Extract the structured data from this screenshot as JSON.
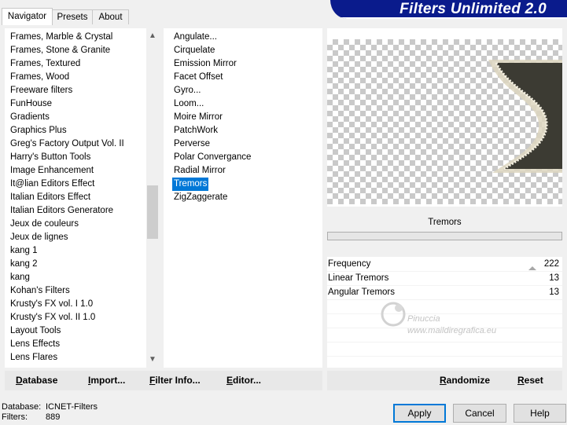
{
  "tabs": [
    {
      "label": "Navigator",
      "active": true
    },
    {
      "label": "Presets",
      "active": false
    },
    {
      "label": "About",
      "active": false
    }
  ],
  "banner": {
    "title": "Filters Unlimited 2.0"
  },
  "categories": [
    "Frames, Marble & Crystal",
    "Frames, Stone & Granite",
    "Frames, Textured",
    "Frames, Wood",
    "Freeware filters",
    "FunHouse",
    "Gradients",
    "Graphics Plus",
    "Greg's Factory Output Vol. II",
    "Harry's Button Tools",
    "Image Enhancement",
    "It@lian Editors Effect",
    "Italian Editors Effect",
    "Italian Editors Generatore",
    "Jeux de couleurs",
    "Jeux de lignes",
    "kang 1",
    "kang 2",
    "kang",
    "Kohan's Filters",
    "Krusty's FX vol. I 1.0",
    "Krusty's FX vol. II 1.0",
    "Layout Tools",
    "Lens Effects",
    "Lens Flares"
  ],
  "filters": [
    "Angulate...",
    "Cirquelate",
    "Emission Mirror",
    "Facet Offset",
    "Gyro...",
    "Loom...",
    "Moire Mirror",
    "PatchWork",
    "Perverse",
    "Polar Convergance",
    "Radial Mirror",
    "Tremors",
    "ZigZaggerate"
  ],
  "selected_filter": "Tremors",
  "preview": {
    "filter_name": "Tremors"
  },
  "params": [
    {
      "label": "Frequency",
      "value": "222",
      "slider": true
    },
    {
      "label": "Linear Tremors",
      "value": "13",
      "slider": false
    },
    {
      "label": "Angular Tremors",
      "value": "13",
      "slider": false
    }
  ],
  "watermark": {
    "name": "Pinuccia",
    "url": "www.maildiregrafica.eu"
  },
  "left_buttons": [
    {
      "ul": "D",
      "rest": "atabase"
    },
    {
      "ul": "I",
      "rest": "mport..."
    },
    {
      "ul": "F",
      "rest": "ilter Info..."
    },
    {
      "ul": "E",
      "rest": "ditor..."
    }
  ],
  "right_buttons": [
    {
      "ul": "R",
      "rest": "andomize"
    },
    {
      "ul": "R",
      "rest": "eset"
    }
  ],
  "status": {
    "database_label": "Database:",
    "database_value": "ICNET-Filters",
    "filters_label": "Filters:",
    "filters_value": "889"
  },
  "dialog": {
    "apply": "Apply",
    "cancel": "Cancel",
    "help": "Help"
  },
  "colors": {
    "banner": "#0a1b8c",
    "selection": "#0078d7"
  }
}
